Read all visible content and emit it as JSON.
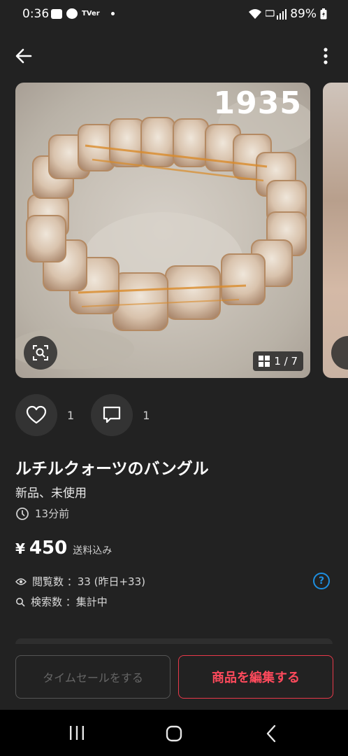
{
  "status_bar": {
    "time": "0:36",
    "left_icons": [
      "youtube-icon",
      "line-icon",
      "tver-icon",
      "dot-icon"
    ],
    "tver_text": "TVer",
    "battery": "89%"
  },
  "top_bar": {
    "back_icon": "back-arrow-icon",
    "more_icon": "more-vertical-icon"
  },
  "image": {
    "number_overlay": "1935",
    "counter": "1 / 7",
    "lens_icon": "image-search-icon"
  },
  "actions": {
    "like_count": "1",
    "comment_count": "1"
  },
  "product": {
    "title": "ルチルクォーツのバングル",
    "condition": "新品、未使用",
    "posted": "13分前",
    "price_yen": "¥",
    "price": "450",
    "shipping": "送料込み",
    "views": "閲覧数 ：33 (昨日+33)",
    "search": "検索数 ：集計中"
  },
  "buttons": {
    "timesale": "タイムセールをする",
    "edit": "商品を編集する"
  },
  "colors": {
    "background": "#222222",
    "accent_red": "#e8394b",
    "help_blue": "#1e8fe0"
  }
}
